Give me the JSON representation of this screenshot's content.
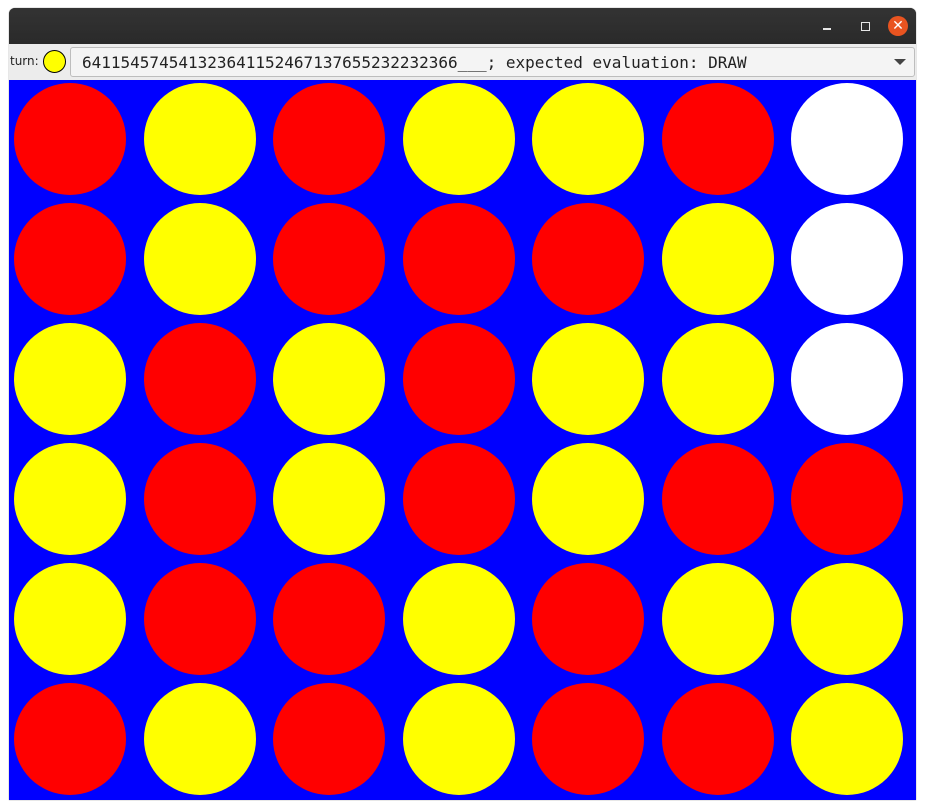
{
  "window": {
    "controls": {
      "minimize_icon": "minimize-icon",
      "maximize_icon": "maximize-icon",
      "close_icon": "close-icon",
      "close_glyph": "✕"
    }
  },
  "toolbar": {
    "turn_label": "turn:",
    "turn_color": "#ffff00",
    "selected_position": "64115457454132364115246713765523223236 6___; expected evaluation: DRAW"
  },
  "colors": {
    "board": "#0000ff",
    "red": "#ff0000",
    "yellow": "#ffff00",
    "empty": "#ffffff"
  },
  "board": {
    "columns": 7,
    "rows": 6,
    "grid": [
      [
        "red",
        "yellow",
        "red",
        "yellow",
        "yellow",
        "red",
        "empty"
      ],
      [
        "red",
        "yellow",
        "red",
        "red",
        "red",
        "yellow",
        "empty"
      ],
      [
        "yellow",
        "red",
        "yellow",
        "red",
        "yellow",
        "yellow",
        "empty"
      ],
      [
        "yellow",
        "red",
        "yellow",
        "red",
        "yellow",
        "red",
        "red"
      ],
      [
        "yellow",
        "red",
        "red",
        "yellow",
        "red",
        "yellow",
        "yellow"
      ],
      [
        "red",
        "yellow",
        "red",
        "yellow",
        "red",
        "red",
        "yellow"
      ]
    ]
  }
}
